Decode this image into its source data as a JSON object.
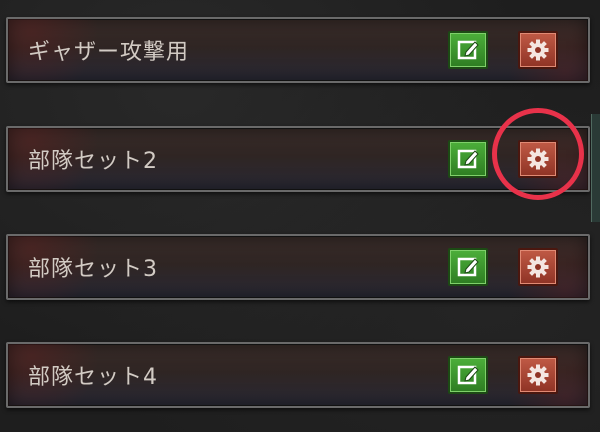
{
  "rows": [
    {
      "label": "ギャザー攻撃用"
    },
    {
      "label": "部隊セット2"
    },
    {
      "label": "部隊セット3"
    },
    {
      "label": "部隊セット4"
    }
  ],
  "icons": {
    "edit": "edit-icon",
    "settings": "gear-icon"
  },
  "colors": {
    "edit_button": "#2e7d22",
    "settings_button": "#8f3325",
    "highlight_ring": "#e8324a"
  }
}
